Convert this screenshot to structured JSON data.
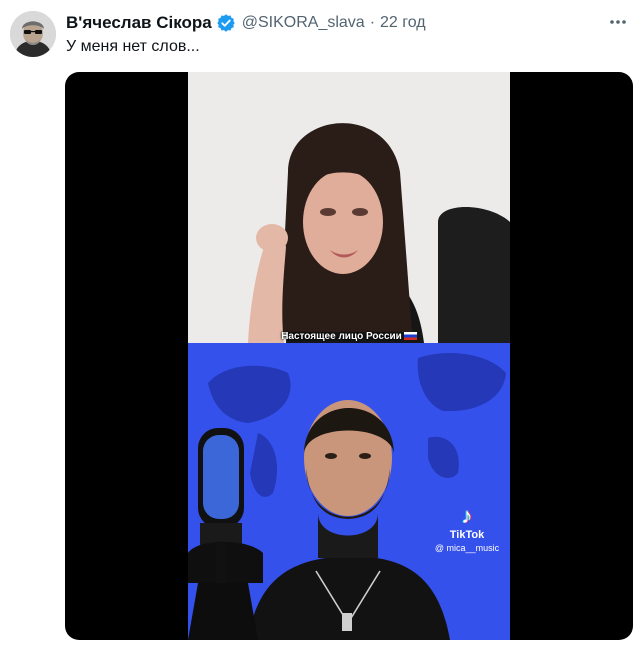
{
  "tweet": {
    "author_name": "В'ячеслав Сікора",
    "verified_icon": "verified-badge-icon",
    "handle": "@SIKORA_slava",
    "separator": "·",
    "time": "22 год",
    "more_icon": "more-dots-icon",
    "text": "У меня нет слов..."
  },
  "video": {
    "caption": "Настоящее лицо России",
    "tiktok_logo": "♪",
    "tiktok_name": "TikTok",
    "tiktok_handle": "@ mica__music"
  },
  "colors": {
    "verified": "#1d9bf0",
    "text_secondary": "#536471",
    "video_blue": "#3a58f0"
  }
}
